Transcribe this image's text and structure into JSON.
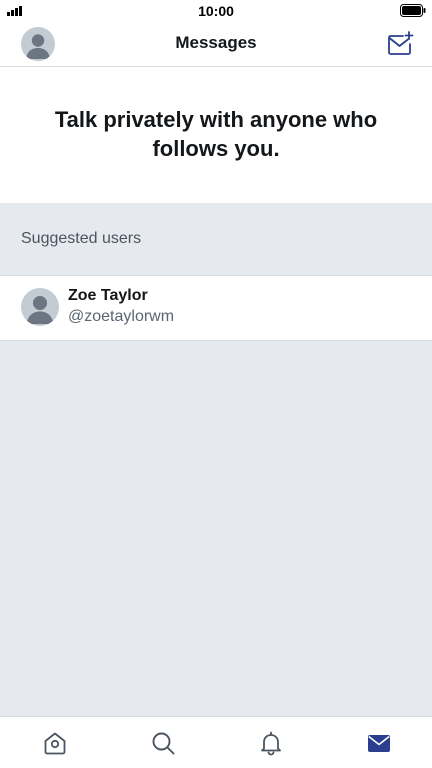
{
  "status_bar": {
    "time": "10:00"
  },
  "header": {
    "title": "Messages",
    "profile_icon": "avatar-icon",
    "compose_icon": "new-message-icon"
  },
  "intro": {
    "text": "Talk privately with anyone who follows you."
  },
  "suggested": {
    "label": "Suggested users",
    "users": [
      {
        "name": "Zoe Taylor",
        "handle": "@zoetaylorwm"
      }
    ]
  },
  "tab_bar": {
    "tabs": [
      {
        "icon": "home-icon"
      },
      {
        "icon": "search-icon"
      },
      {
        "icon": "bell-icon"
      },
      {
        "icon": "mail-icon",
        "active": true
      }
    ]
  },
  "colors": {
    "accent": "#2a3f8f",
    "background": "#e6e9ee",
    "text_primary": "#14171a",
    "text_secondary": "#5b6672",
    "icon": "#4a5560"
  }
}
